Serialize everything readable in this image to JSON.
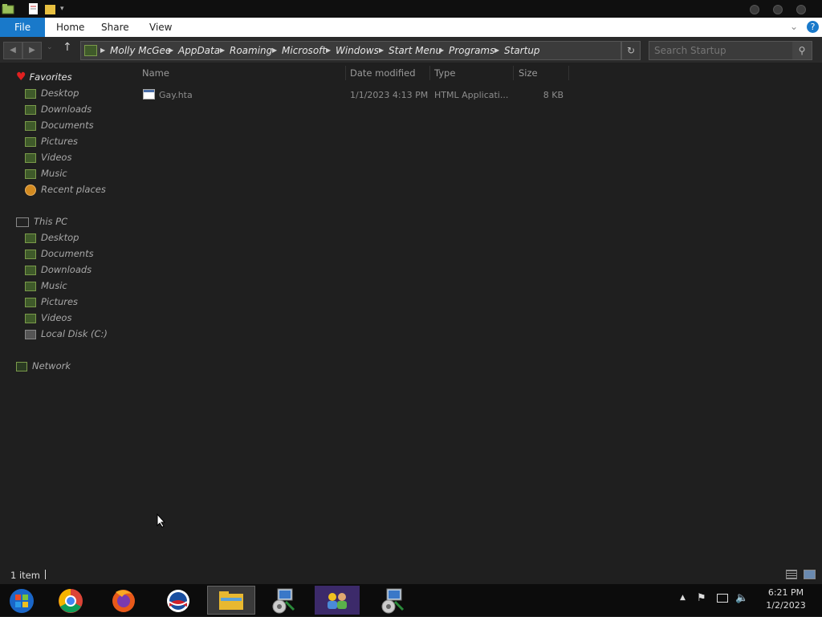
{
  "ribbon": {
    "tabs": [
      {
        "label": "File"
      },
      {
        "label": "Home"
      },
      {
        "label": "Share"
      },
      {
        "label": "View"
      }
    ]
  },
  "address": {
    "crumbs": [
      "Molly McGee",
      "AppData",
      "Roaming",
      "Microsoft",
      "Windows",
      "Start Menu",
      "Programs",
      "Startup"
    ]
  },
  "search": {
    "placeholder": "Search Startup"
  },
  "nav": {
    "favorites": {
      "label": "Favorites",
      "items": [
        "Desktop",
        "Downloads",
        "Documents",
        "Pictures",
        "Videos",
        "Music",
        "Recent places"
      ]
    },
    "this_pc": {
      "label": "This PC",
      "items": [
        "Desktop",
        "Documents",
        "Downloads",
        "Music",
        "Pictures",
        "Videos",
        "Local Disk (C:)"
      ]
    },
    "network": {
      "label": "Network"
    }
  },
  "columns": {
    "name": "Name",
    "date": "Date modified",
    "type": "Type",
    "size": "Size"
  },
  "files": [
    {
      "name": "Gay.hta",
      "date": "1/1/2023 4:13 PM",
      "type": "HTML Applicati...",
      "size": "8 KB"
    }
  ],
  "status": {
    "count": "1 item"
  },
  "taskbar": {
    "apps": [
      "start-icon",
      "chrome-icon",
      "firefox-icon",
      "campaign-logo-icon",
      "file-explorer-icon",
      "setup-icon",
      "users-icon",
      "setup-icon"
    ],
    "clock_time": "6:21 PM",
    "clock_date": "1/2/2023"
  },
  "colors": {
    "file_tab": "#1979ca",
    "background": "#1f1f1f"
  }
}
